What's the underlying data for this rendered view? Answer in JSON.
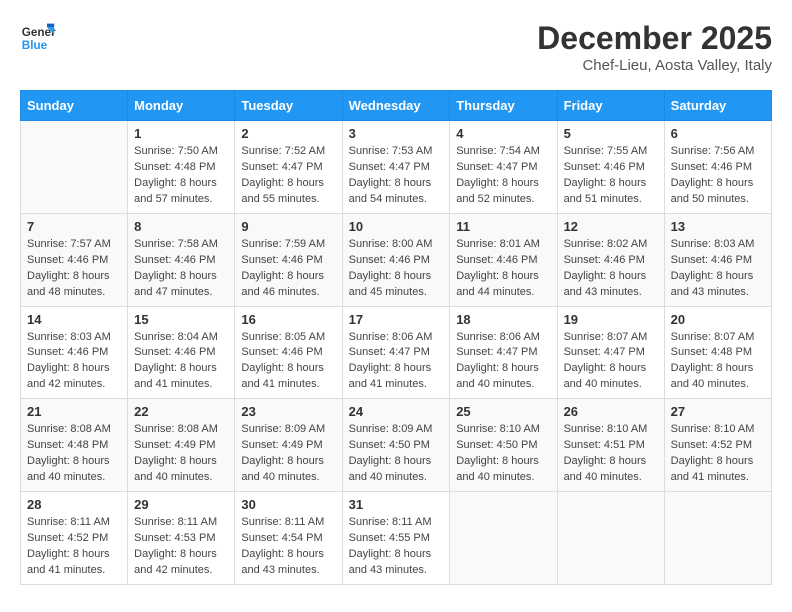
{
  "header": {
    "logo_line1": "General",
    "logo_line2": "Blue",
    "month_title": "December 2025",
    "location": "Chef-Lieu, Aosta Valley, Italy"
  },
  "days_of_week": [
    "Sunday",
    "Monday",
    "Tuesday",
    "Wednesday",
    "Thursday",
    "Friday",
    "Saturday"
  ],
  "weeks": [
    [
      {
        "day": "",
        "sunrise": "",
        "sunset": "",
        "daylight": ""
      },
      {
        "day": "1",
        "sunrise": "Sunrise: 7:50 AM",
        "sunset": "Sunset: 4:48 PM",
        "daylight": "Daylight: 8 hours and 57 minutes."
      },
      {
        "day": "2",
        "sunrise": "Sunrise: 7:52 AM",
        "sunset": "Sunset: 4:47 PM",
        "daylight": "Daylight: 8 hours and 55 minutes."
      },
      {
        "day": "3",
        "sunrise": "Sunrise: 7:53 AM",
        "sunset": "Sunset: 4:47 PM",
        "daylight": "Daylight: 8 hours and 54 minutes."
      },
      {
        "day": "4",
        "sunrise": "Sunrise: 7:54 AM",
        "sunset": "Sunset: 4:47 PM",
        "daylight": "Daylight: 8 hours and 52 minutes."
      },
      {
        "day": "5",
        "sunrise": "Sunrise: 7:55 AM",
        "sunset": "Sunset: 4:46 PM",
        "daylight": "Daylight: 8 hours and 51 minutes."
      },
      {
        "day": "6",
        "sunrise": "Sunrise: 7:56 AM",
        "sunset": "Sunset: 4:46 PM",
        "daylight": "Daylight: 8 hours and 50 minutes."
      }
    ],
    [
      {
        "day": "7",
        "sunrise": "Sunrise: 7:57 AM",
        "sunset": "Sunset: 4:46 PM",
        "daylight": "Daylight: 8 hours and 48 minutes."
      },
      {
        "day": "8",
        "sunrise": "Sunrise: 7:58 AM",
        "sunset": "Sunset: 4:46 PM",
        "daylight": "Daylight: 8 hours and 47 minutes."
      },
      {
        "day": "9",
        "sunrise": "Sunrise: 7:59 AM",
        "sunset": "Sunset: 4:46 PM",
        "daylight": "Daylight: 8 hours and 46 minutes."
      },
      {
        "day": "10",
        "sunrise": "Sunrise: 8:00 AM",
        "sunset": "Sunset: 4:46 PM",
        "daylight": "Daylight: 8 hours and 45 minutes."
      },
      {
        "day": "11",
        "sunrise": "Sunrise: 8:01 AM",
        "sunset": "Sunset: 4:46 PM",
        "daylight": "Daylight: 8 hours and 44 minutes."
      },
      {
        "day": "12",
        "sunrise": "Sunrise: 8:02 AM",
        "sunset": "Sunset: 4:46 PM",
        "daylight": "Daylight: 8 hours and 43 minutes."
      },
      {
        "day": "13",
        "sunrise": "Sunrise: 8:03 AM",
        "sunset": "Sunset: 4:46 PM",
        "daylight": "Daylight: 8 hours and 43 minutes."
      }
    ],
    [
      {
        "day": "14",
        "sunrise": "Sunrise: 8:03 AM",
        "sunset": "Sunset: 4:46 PM",
        "daylight": "Daylight: 8 hours and 42 minutes."
      },
      {
        "day": "15",
        "sunrise": "Sunrise: 8:04 AM",
        "sunset": "Sunset: 4:46 PM",
        "daylight": "Daylight: 8 hours and 41 minutes."
      },
      {
        "day": "16",
        "sunrise": "Sunrise: 8:05 AM",
        "sunset": "Sunset: 4:46 PM",
        "daylight": "Daylight: 8 hours and 41 minutes."
      },
      {
        "day": "17",
        "sunrise": "Sunrise: 8:06 AM",
        "sunset": "Sunset: 4:47 PM",
        "daylight": "Daylight: 8 hours and 41 minutes."
      },
      {
        "day": "18",
        "sunrise": "Sunrise: 8:06 AM",
        "sunset": "Sunset: 4:47 PM",
        "daylight": "Daylight: 8 hours and 40 minutes."
      },
      {
        "day": "19",
        "sunrise": "Sunrise: 8:07 AM",
        "sunset": "Sunset: 4:47 PM",
        "daylight": "Daylight: 8 hours and 40 minutes."
      },
      {
        "day": "20",
        "sunrise": "Sunrise: 8:07 AM",
        "sunset": "Sunset: 4:48 PM",
        "daylight": "Daylight: 8 hours and 40 minutes."
      }
    ],
    [
      {
        "day": "21",
        "sunrise": "Sunrise: 8:08 AM",
        "sunset": "Sunset: 4:48 PM",
        "daylight": "Daylight: 8 hours and 40 minutes."
      },
      {
        "day": "22",
        "sunrise": "Sunrise: 8:08 AM",
        "sunset": "Sunset: 4:49 PM",
        "daylight": "Daylight: 8 hours and 40 minutes."
      },
      {
        "day": "23",
        "sunrise": "Sunrise: 8:09 AM",
        "sunset": "Sunset: 4:49 PM",
        "daylight": "Daylight: 8 hours and 40 minutes."
      },
      {
        "day": "24",
        "sunrise": "Sunrise: 8:09 AM",
        "sunset": "Sunset: 4:50 PM",
        "daylight": "Daylight: 8 hours and 40 minutes."
      },
      {
        "day": "25",
        "sunrise": "Sunrise: 8:10 AM",
        "sunset": "Sunset: 4:50 PM",
        "daylight": "Daylight: 8 hours and 40 minutes."
      },
      {
        "day": "26",
        "sunrise": "Sunrise: 8:10 AM",
        "sunset": "Sunset: 4:51 PM",
        "daylight": "Daylight: 8 hours and 40 minutes."
      },
      {
        "day": "27",
        "sunrise": "Sunrise: 8:10 AM",
        "sunset": "Sunset: 4:52 PM",
        "daylight": "Daylight: 8 hours and 41 minutes."
      }
    ],
    [
      {
        "day": "28",
        "sunrise": "Sunrise: 8:11 AM",
        "sunset": "Sunset: 4:52 PM",
        "daylight": "Daylight: 8 hours and 41 minutes."
      },
      {
        "day": "29",
        "sunrise": "Sunrise: 8:11 AM",
        "sunset": "Sunset: 4:53 PM",
        "daylight": "Daylight: 8 hours and 42 minutes."
      },
      {
        "day": "30",
        "sunrise": "Sunrise: 8:11 AM",
        "sunset": "Sunset: 4:54 PM",
        "daylight": "Daylight: 8 hours and 43 minutes."
      },
      {
        "day": "31",
        "sunrise": "Sunrise: 8:11 AM",
        "sunset": "Sunset: 4:55 PM",
        "daylight": "Daylight: 8 hours and 43 minutes."
      },
      {
        "day": "",
        "sunrise": "",
        "sunset": "",
        "daylight": ""
      },
      {
        "day": "",
        "sunrise": "",
        "sunset": "",
        "daylight": ""
      },
      {
        "day": "",
        "sunrise": "",
        "sunset": "",
        "daylight": ""
      }
    ]
  ]
}
